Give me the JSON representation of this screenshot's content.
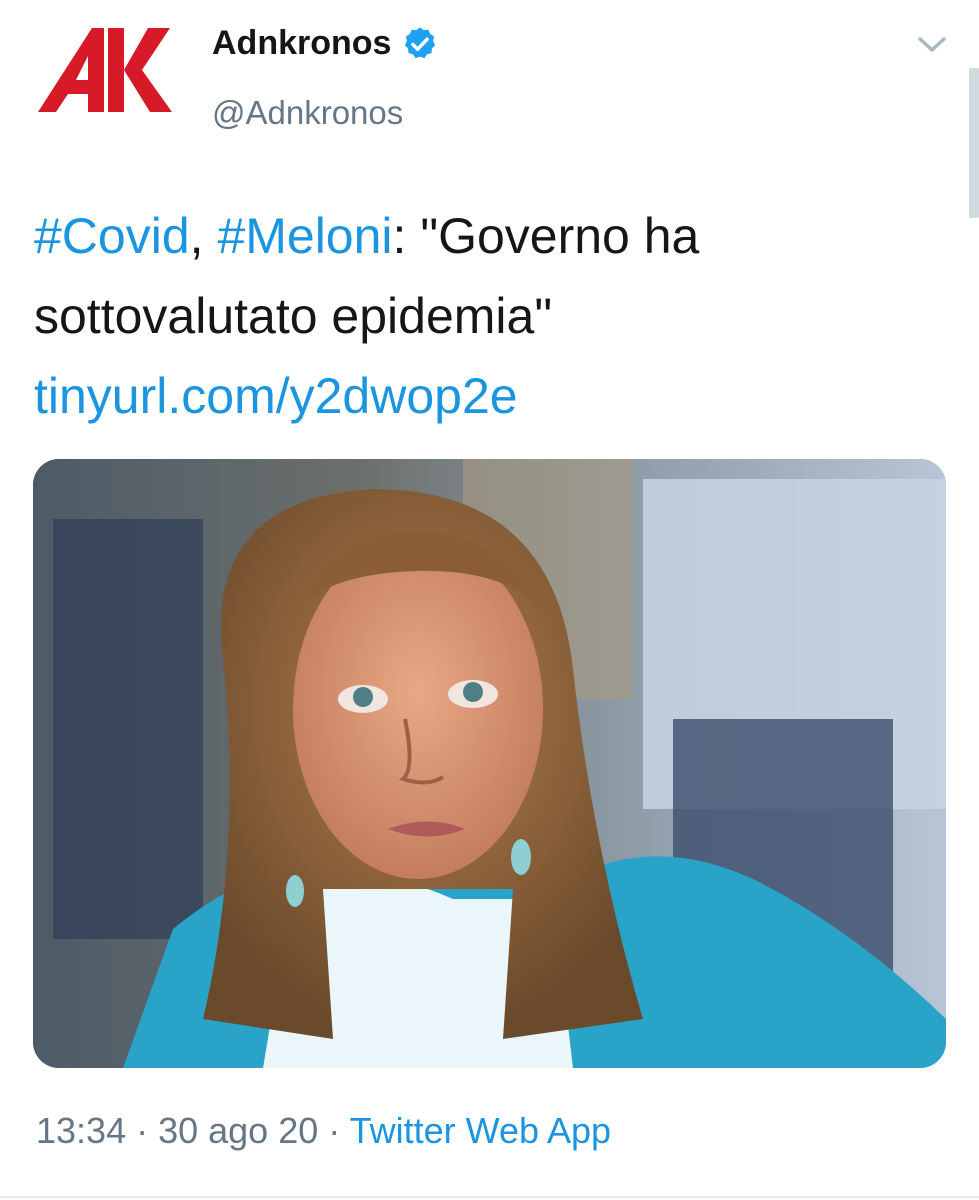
{
  "account": {
    "display_name": "Adnkronos",
    "handle": "@Adnkronos",
    "verified_icon": "verified-badge-icon",
    "avatar_icon": "adnkronos-logo-icon",
    "avatar_color": "#d71a28"
  },
  "menu": {
    "icon": "chevron-down-icon"
  },
  "tweet": {
    "hashtag_1": "#Covid",
    "separator": ", ",
    "hashtag_2": "#Meloni",
    "text_after_hashtags": ": \"Governo ha sottovalutato epidemia\"",
    "link": "tinyurl.com/y2dwop2e"
  },
  "media": {
    "type": "photo"
  },
  "meta": {
    "time": "13:34",
    "dot_1": " · ",
    "date": "30 ago 20",
    "dot_2": " · ",
    "source": "Twitter Web App"
  },
  "colors": {
    "link": "#1b95e0",
    "text": "#14171a",
    "muted": "#657786",
    "verified": "#1da1f2"
  }
}
